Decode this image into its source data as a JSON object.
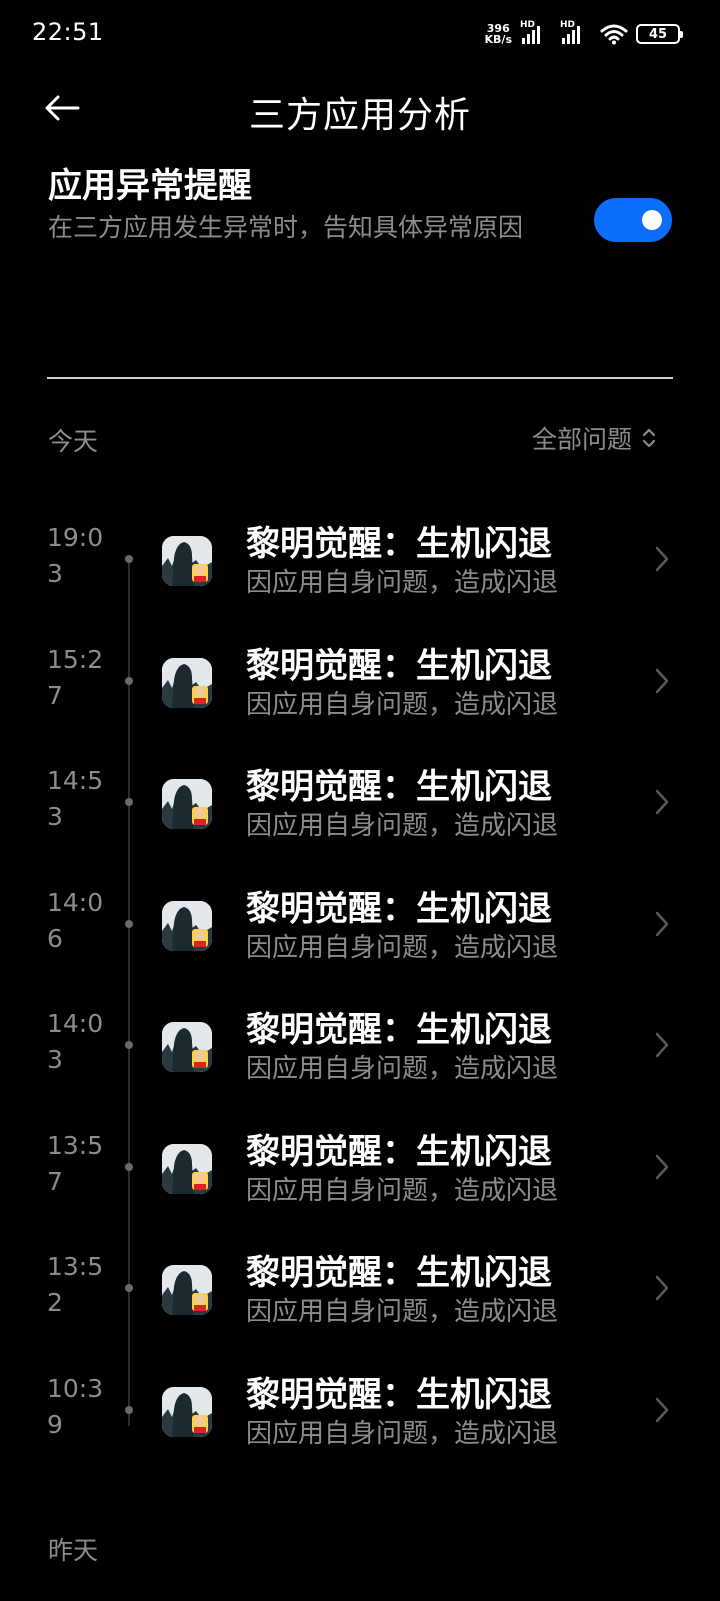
{
  "status_bar": {
    "time": "22:51",
    "net_speed_value": "396",
    "net_speed_unit": "KB/s",
    "hd_label_1": "HD",
    "hd_label_2": "HD",
    "battery": "45",
    "icons": [
      "signal-icon",
      "signal-icon",
      "wifi-icon",
      "battery-icon"
    ]
  },
  "header": {
    "title": "三方应用分析",
    "back_icon": "back-arrow-icon"
  },
  "setting": {
    "title": "应用异常提醒",
    "description": "在三方应用发生异常时，告知具体异常原因",
    "enabled": true,
    "toggle_color": "#0d6efd"
  },
  "today": {
    "label": "今天",
    "filter_label": "全部问题",
    "filter_icon": "sort-updown-icon"
  },
  "events": [
    {
      "time": "19:03",
      "title": "黎明觉醒：生机闪退",
      "subtitle": "因应用自身问题，造成闪退"
    },
    {
      "time": "15:27",
      "title": "黎明觉醒：生机闪退",
      "subtitle": "因应用自身问题，造成闪退"
    },
    {
      "time": "14:53",
      "title": "黎明觉醒：生机闪退",
      "subtitle": "因应用自身问题，造成闪退"
    },
    {
      "time": "14:06",
      "title": "黎明觉醒：生机闪退",
      "subtitle": "因应用自身问题，造成闪退"
    },
    {
      "time": "14:03",
      "title": "黎明觉醒：生机闪退",
      "subtitle": "因应用自身问题，造成闪退"
    },
    {
      "time": "13:57",
      "title": "黎明觉醒：生机闪退",
      "subtitle": "因应用自身问题，造成闪退"
    },
    {
      "time": "13:52",
      "title": "黎明觉醒：生机闪退",
      "subtitle": "因应用自身问题，造成闪退"
    },
    {
      "time": "10:39",
      "title": "黎明觉醒：生机闪退",
      "subtitle": "因应用自身问题，造成闪退"
    }
  ],
  "yesterday": {
    "label": "昨天"
  }
}
